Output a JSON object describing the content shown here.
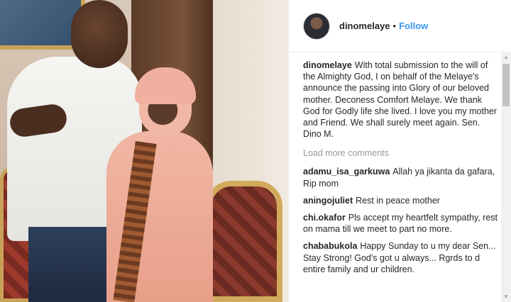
{
  "post": {
    "username": "dinomelaye",
    "separator": "•",
    "follow_label": "Follow",
    "caption_user": "dinomelaye",
    "caption_text": "With total submission to the will of the Almighty God, I on behalf of the Melaye's announce the passing into Glory of our beloved mother. Deconess Comfort Melaye. We thank God for Godly life she lived. I love you my mother and Friend. We shall surely meet again. Sen. Dino M."
  },
  "load_more_label": "Load more comments",
  "comments": [
    {
      "user": "adamu_isa_garkuwa",
      "text": "Allah ya jikanta da gafara, Rip mom"
    },
    {
      "user": "aningojuliet",
      "text": "Rest in peace mother"
    },
    {
      "user": "chi.okafor",
      "text": "Pls accept my heartfelt sympathy, rest on mama till we meet to part no more."
    },
    {
      "user": "chababukola",
      "text": "Happy Sunday to u my dear Sen... Stay Strong! God's got u always... Rgrds to d entire family and ur children."
    }
  ],
  "icons": {
    "scroll_up": "▲",
    "scroll_down": "▼"
  }
}
